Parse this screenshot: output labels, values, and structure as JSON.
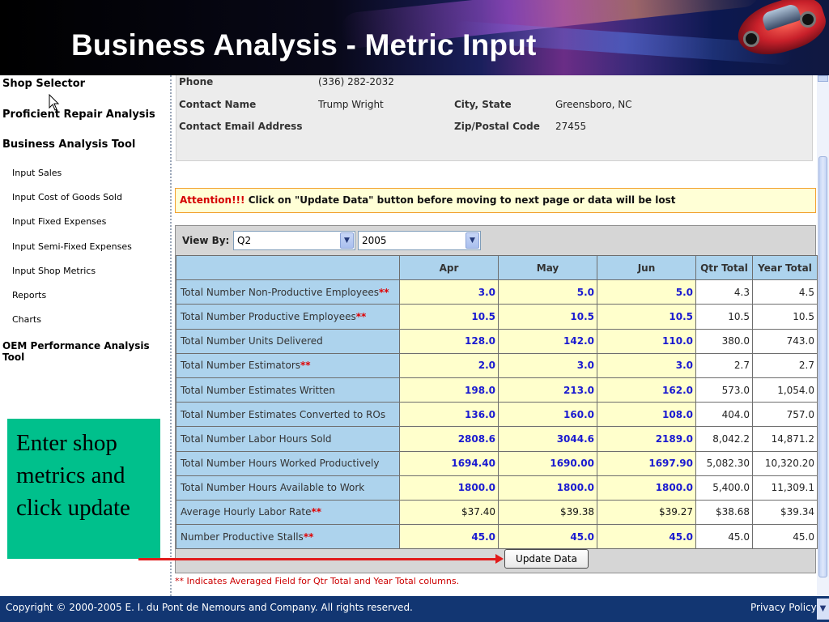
{
  "title": "Business Analysis - Metric Input",
  "sidebar": {
    "items": [
      {
        "label": "Shop Selector",
        "level": "main"
      },
      {
        "label": "Proficient Repair Analysis",
        "level": "main"
      },
      {
        "label": "Business Analysis Tool",
        "level": "main"
      },
      {
        "label": "Input Sales",
        "level": "sub"
      },
      {
        "label": "Input Cost of Goods Sold",
        "level": "sub"
      },
      {
        "label": "Input Fixed Expenses",
        "level": "sub"
      },
      {
        "label": "Input Semi-Fixed Expenses",
        "level": "sub"
      },
      {
        "label": "Input Shop Metrics",
        "level": "sub"
      },
      {
        "label": "Reports",
        "level": "sub"
      },
      {
        "label": "Charts",
        "level": "sub"
      },
      {
        "label": "OEM Performance Analysis Tool",
        "level": "main"
      }
    ]
  },
  "shop_info": {
    "phone_label": "Phone",
    "phone_value": "(336) 282-2032",
    "contact_label": "Contact Name",
    "contact_value": "Trump Wright",
    "city_label": "City, State",
    "city_value": "Greensboro, NC",
    "email_label": "Contact Email Address",
    "zip_label": "Zip/Postal Code",
    "zip_value": "27455"
  },
  "attention": {
    "prefix": "Attention!!!",
    "message": "Click on \"Update Data\" button before moving to next page or data will be lost"
  },
  "view_by": {
    "label": "View By:",
    "quarter": "Q2",
    "year": "2005"
  },
  "table": {
    "columns": [
      "Apr",
      "May",
      "Jun",
      "Qtr Total",
      "Year Total"
    ],
    "rows": [
      {
        "metric": "Total Number Non-Productive Employees",
        "marker": "**",
        "apr": "3.0",
        "may": "5.0",
        "jun": "5.0",
        "qtr": "4.3",
        "year": "4.5"
      },
      {
        "metric": "Total Number Productive Employees",
        "marker": "**",
        "apr": "10.5",
        "may": "10.5",
        "jun": "10.5",
        "qtr": "10.5",
        "year": "10.5"
      },
      {
        "metric": "Total Number Units Delivered",
        "marker": "",
        "apr": "128.0",
        "may": "142.0",
        "jun": "110.0",
        "qtr": "380.0",
        "year": "743.0"
      },
      {
        "metric": "Total Number Estimators",
        "marker": "**",
        "apr": "2.0",
        "may": "3.0",
        "jun": "3.0",
        "qtr": "2.7",
        "year": "2.7"
      },
      {
        "metric": "Total Number Estimates Written",
        "marker": "",
        "apr": "198.0",
        "may": "213.0",
        "jun": "162.0",
        "qtr": "573.0",
        "year": "1,054.0"
      },
      {
        "metric": "Total Number Estimates Converted to ROs",
        "marker": "",
        "apr": "136.0",
        "may": "160.0",
        "jun": "108.0",
        "qtr": "404.0",
        "year": "757.0"
      },
      {
        "metric": "Total Number Labor Hours Sold",
        "marker": "",
        "apr": "2808.6",
        "may": "3044.6",
        "jun": "2189.0",
        "qtr": "8,042.2",
        "year": "14,871.2"
      },
      {
        "metric": "Total Number Hours Worked Productively",
        "marker": "",
        "apr": "1694.40",
        "may": "1690.00",
        "jun": "1697.90",
        "qtr": "5,082.30",
        "year": "10,320.20"
      },
      {
        "metric": "Total Number Hours Available to Work",
        "marker": "",
        "apr": "1800.0",
        "may": "1800.0",
        "jun": "1800.0",
        "qtr": "5,400.0",
        "year": "11,309.1"
      },
      {
        "metric": "Average Hourly Labor Rate",
        "marker": "**",
        "apr": "$37.40",
        "may": "$39.38",
        "jun": "$39.27",
        "qtr": "$38.68",
        "year": "$39.34",
        "plain": true
      },
      {
        "metric": "Number Productive Stalls",
        "marker": "**",
        "apr": "45.0",
        "may": "45.0",
        "jun": "45.0",
        "qtr": "45.0",
        "year": "45.0"
      }
    ]
  },
  "update_button": "Update Data",
  "footnote": "** Indicates Averaged Field for Qtr Total and Year Total columns.",
  "callout": "Enter shop metrics and click update",
  "footer": {
    "copyright": "Copyright © 2000-2005 E. I. du Pont de Nemours and Company. All rights reserved.",
    "privacy": "Privacy Policy"
  }
}
